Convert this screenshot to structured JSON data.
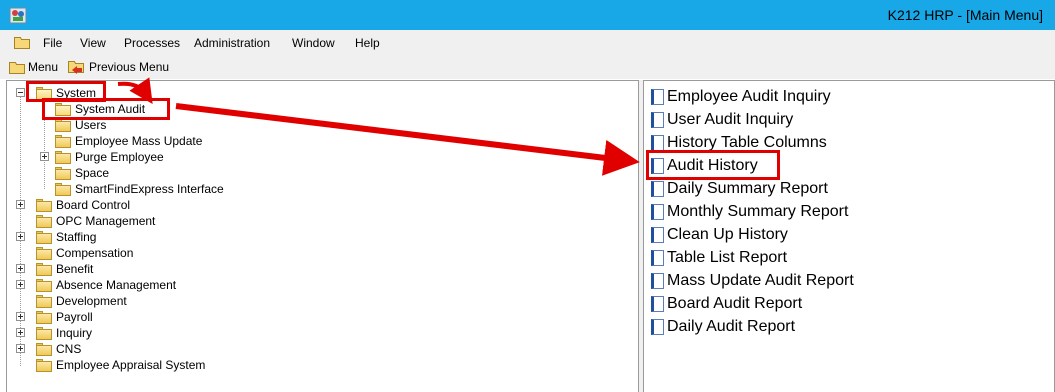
{
  "window": {
    "title": "K212 HRP - [Main Menu]",
    "icon": "app-icon"
  },
  "menubar": {
    "items": [
      "File",
      "View",
      "Processes",
      "Administration",
      "Window",
      "Help"
    ]
  },
  "toolbar": {
    "menu_label": "Menu",
    "previous_label": "Previous Menu"
  },
  "tree": {
    "items": [
      {
        "label": "System",
        "expanded": true,
        "highlighted": true
      },
      {
        "label": "System Audit",
        "selected": true,
        "highlighted": true
      },
      {
        "label": "Users"
      },
      {
        "label": "Employee Mass Update"
      },
      {
        "label": "Purge Employee",
        "expandable": true
      },
      {
        "label": "Space"
      },
      {
        "label": "SmartFindExpress Interface"
      },
      {
        "label": "Board Control",
        "expandable": true
      },
      {
        "label": "OPC Management"
      },
      {
        "label": "Staffing",
        "expandable": true
      },
      {
        "label": "Compensation"
      },
      {
        "label": "Benefit",
        "expandable": true
      },
      {
        "label": "Absence Management",
        "expandable": true
      },
      {
        "label": "Development"
      },
      {
        "label": "Payroll",
        "expandable": true
      },
      {
        "label": "Inquiry",
        "expandable": true
      },
      {
        "label": "CNS",
        "expandable": true
      },
      {
        "label": "Employee Appraisal System"
      }
    ]
  },
  "functions": {
    "items": [
      {
        "label": "Employee Audit Inquiry"
      },
      {
        "label": "User Audit Inquiry"
      },
      {
        "label": "History Table Columns"
      },
      {
        "label": "Audit History",
        "highlighted": true
      },
      {
        "label": "Daily Summary Report"
      },
      {
        "label": "Monthly Summary Report"
      },
      {
        "label": "Clean Up History"
      },
      {
        "label": "Table List Report"
      },
      {
        "label": "Mass Update Audit Report"
      },
      {
        "label": "Board Audit Report"
      },
      {
        "label": "Daily Audit Report"
      }
    ]
  },
  "colors": {
    "titlebar": "#18a8e8",
    "annotation": "#e00000",
    "chrome": "#f0f0f0"
  }
}
